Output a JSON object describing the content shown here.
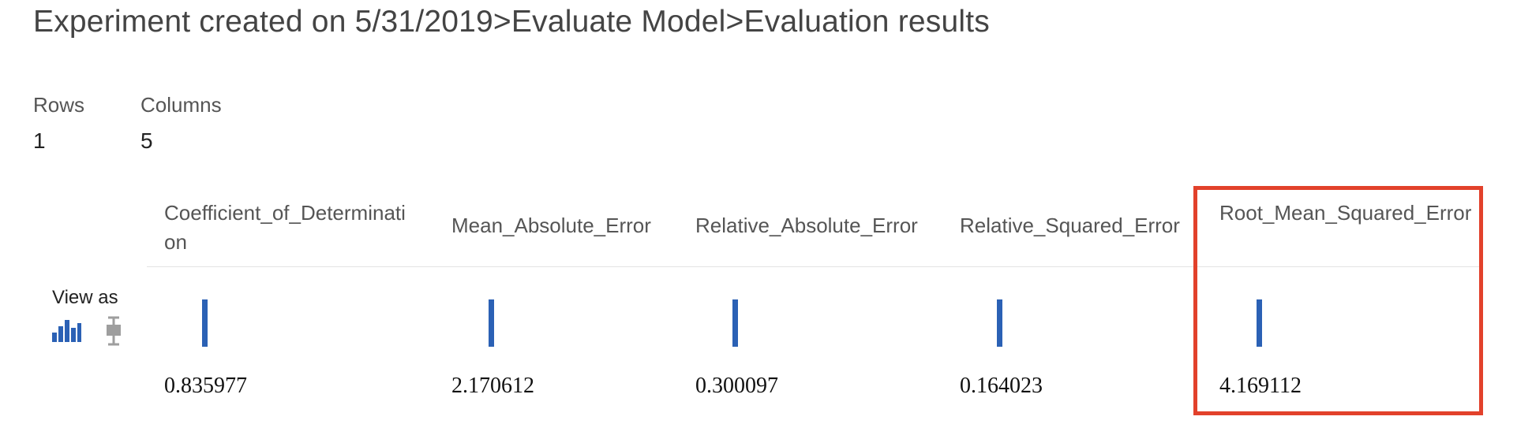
{
  "breadcrumb": {
    "experiment": "Experiment created on 5/31/2019",
    "separator": ">",
    "module": "Evaluate Model",
    "output": "Evaluation results"
  },
  "stats": {
    "rows_label": "Rows",
    "rows_value": "1",
    "columns_label": "Columns",
    "columns_value": "5"
  },
  "view_as": {
    "label": "View as",
    "options": [
      "histogram-icon",
      "boxplot-icon"
    ],
    "selected": "histogram-icon"
  },
  "table": {
    "columns": [
      {
        "header": "Coefficient_of_Determination",
        "value": "0.835977"
      },
      {
        "header": "Mean_Absolute_Error",
        "value": "2.170612"
      },
      {
        "header": "Relative_Absolute_Error",
        "value": "0.300097"
      },
      {
        "header": "Relative_Squared_Error",
        "value": "0.164023"
      },
      {
        "header": "Root_Mean_Squared_Error",
        "value": "4.169112"
      }
    ]
  },
  "colors": {
    "accent": "#2b61b5",
    "highlight": "#e2412b",
    "icon_inactive": "#9e9e9e"
  }
}
